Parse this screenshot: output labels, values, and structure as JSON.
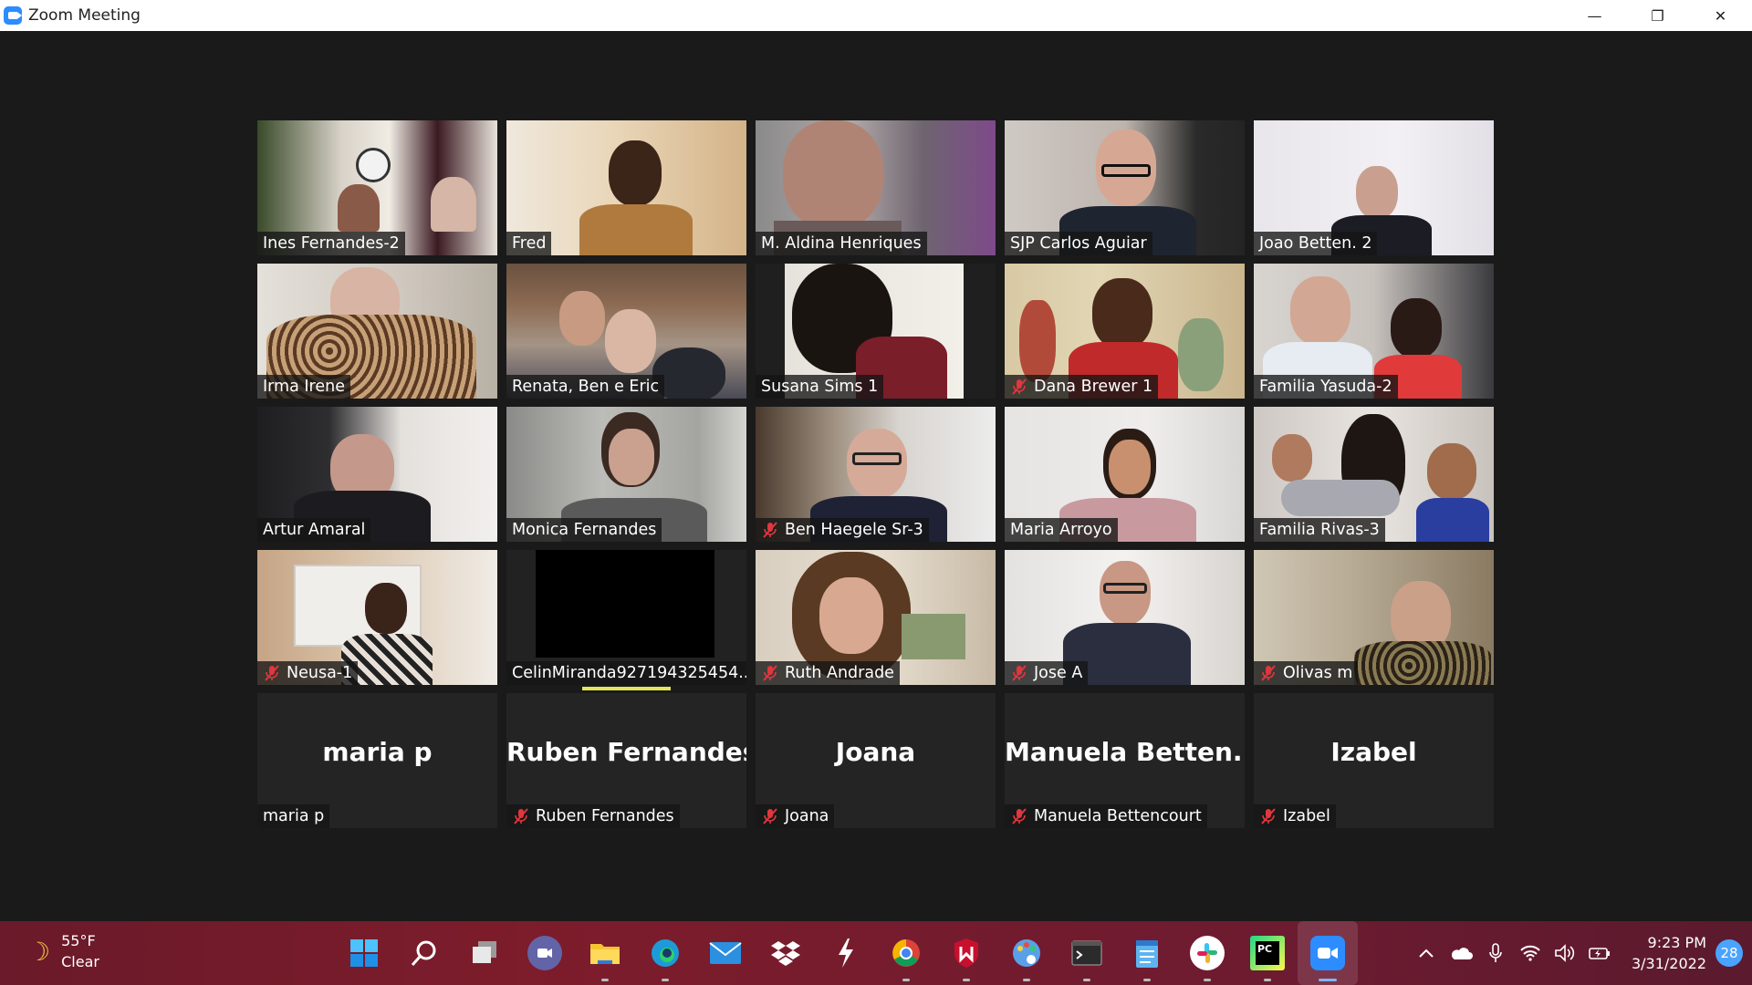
{
  "window": {
    "title": "Zoom Meeting",
    "minimize_glyph": "—",
    "maximize_glyph": "❐",
    "close_glyph": "✕"
  },
  "participants": [
    {
      "id": "ines",
      "name": "Ines Fernandes-2",
      "muted": false
    },
    {
      "id": "fred",
      "name": "Fred",
      "muted": false
    },
    {
      "id": "aldina",
      "name": "M. Aldina Henriques",
      "muted": false
    },
    {
      "id": "carlos",
      "name": "SJP  Carlos  Aguiar",
      "muted": false
    },
    {
      "id": "joao",
      "name": "Joao Betten.  2",
      "muted": false
    },
    {
      "id": "irma",
      "name": "Irma Irene",
      "muted": false
    },
    {
      "id": "renata",
      "name": "Renata, Ben e Eric",
      "muted": false
    },
    {
      "id": "susana",
      "name": "Susana Sims 1",
      "muted": false
    },
    {
      "id": "dana",
      "name": "Dana Brewer 1",
      "muted": true
    },
    {
      "id": "yasuda",
      "name": "Familia Yasuda-2",
      "muted": false
    },
    {
      "id": "artur",
      "name": "Artur Amaral",
      "muted": false
    },
    {
      "id": "monica",
      "name": "Monica Fernandes",
      "muted": false,
      "active_speaker": true
    },
    {
      "id": "ben",
      "name": "Ben Haegele Sr-3",
      "muted": true
    },
    {
      "id": "mariaa",
      "name": "Maria Arroyo",
      "muted": false
    },
    {
      "id": "rivas",
      "name": "Familia Rivas-3",
      "muted": false
    },
    {
      "id": "neusa",
      "name": "Neusa-1",
      "muted": true
    },
    {
      "id": "celin",
      "name": "CelinMiranda927194325454...",
      "muted": false
    },
    {
      "id": "ruth",
      "name": "Ruth Andrade",
      "muted": true
    },
    {
      "id": "jose",
      "name": "Jose A",
      "muted": true
    },
    {
      "id": "olivas",
      "name": "Olivas m",
      "muted": true
    },
    {
      "id": "mariap",
      "name": "maria p",
      "display_name": "maria p",
      "muted": false,
      "video_off": true
    },
    {
      "id": "ruben",
      "name": "Ruben Fernandes",
      "display_name": "Ruben Fernandes",
      "muted": true,
      "video_off": true
    },
    {
      "id": "joana",
      "name": "Joana",
      "display_name": "Joana",
      "muted": true,
      "video_off": true
    },
    {
      "id": "manuela",
      "name": "Manuela Bettencourt",
      "display_name": "Manuela  Betten...",
      "muted": true,
      "video_off": true
    },
    {
      "id": "izabel",
      "name": "Izabel",
      "display_name": "Izabel",
      "muted": true,
      "video_off": true
    }
  ],
  "colors": {
    "active_speaker_border": "#e1e65a",
    "mute_icon": "#e0363d",
    "stage_bg": "#1a1a1a"
  },
  "taskbar": {
    "weather": {
      "temp": "55°F",
      "condition": "Clear",
      "icon": "moon-icon"
    },
    "apps": [
      {
        "name": "start-button",
        "icon": "windows-icon"
      },
      {
        "name": "search-button",
        "icon": "search-icon"
      },
      {
        "name": "task-view-button",
        "icon": "task-view-icon"
      },
      {
        "name": "teams-chat-button",
        "icon": "chat-icon"
      },
      {
        "name": "file-explorer-button",
        "icon": "folder-icon"
      },
      {
        "name": "edge-button",
        "icon": "edge-icon"
      },
      {
        "name": "mail-button",
        "icon": "mail-icon"
      },
      {
        "name": "dropbox-button",
        "icon": "dropbox-icon"
      },
      {
        "name": "app-bolt-button",
        "icon": "bolt-icon"
      },
      {
        "name": "chrome-button",
        "icon": "chrome-icon"
      },
      {
        "name": "mcafee-button",
        "icon": "mcafee-icon"
      },
      {
        "name": "paint-button",
        "icon": "palette-icon"
      },
      {
        "name": "terminal-button",
        "icon": "terminal-icon"
      },
      {
        "name": "notepad-button",
        "icon": "notepad-icon"
      },
      {
        "name": "slack-button",
        "icon": "slack-icon"
      },
      {
        "name": "pycharm-button",
        "icon": "pycharm-icon",
        "text": "PC"
      },
      {
        "name": "zoom-button",
        "icon": "zoom-icon"
      }
    ],
    "clock": {
      "time": "9:23 PM",
      "date": "3/31/2022"
    },
    "notifications": "28"
  }
}
